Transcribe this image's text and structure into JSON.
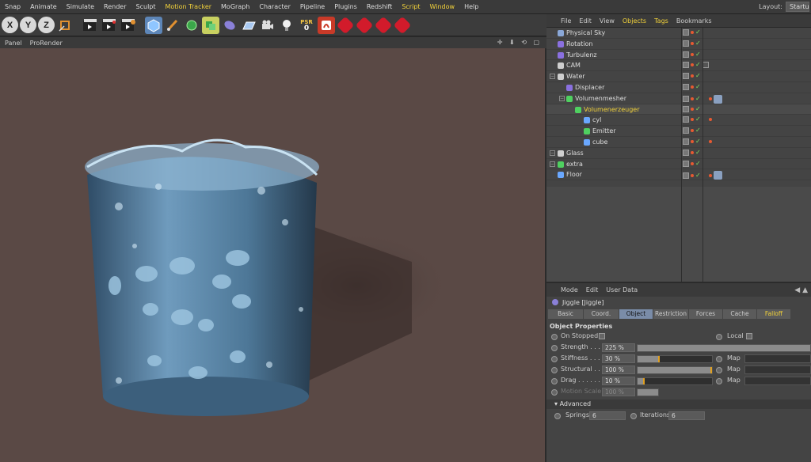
{
  "menubar": {
    "items": [
      "Snap",
      "Animate",
      "Simulate",
      "Render",
      "Sculpt",
      "Motion Tracker",
      "MoGraph",
      "Character",
      "Pipeline",
      "Plugins",
      "Redshift",
      "Script",
      "Window",
      "Help"
    ],
    "layout_label": "Layout:",
    "layout_value": "Startup"
  },
  "toolbar": {
    "axis": [
      "X",
      "Y",
      "Z"
    ],
    "psr_label": "PSR",
    "psr_value": "0"
  },
  "viewport": {
    "menu": [
      "Panel",
      "ProRender"
    ],
    "nav_icons": "✛ ⬇ ⟲ ▢"
  },
  "objects": {
    "menu": [
      "File",
      "Edit",
      "View",
      "Objects",
      "Tags",
      "Bookmarks"
    ],
    "active_menu": "Objects",
    "rows": [
      {
        "name": "Physical Sky",
        "indent": 0,
        "color": "#8aa8d8",
        "tag": "none"
      },
      {
        "name": "Rotation",
        "indent": 0,
        "color": "#8a70e0",
        "tag": "none"
      },
      {
        "name": "Turbulenz",
        "indent": 0,
        "color": "#8a70e0",
        "tag": "none"
      },
      {
        "name": "CAM",
        "indent": 0,
        "color": "#cfcfcf",
        "tag": "cam"
      },
      {
        "name": "Water",
        "indent": 0,
        "color": "#cfcfcf",
        "tag": "none"
      },
      {
        "name": "Displacer",
        "indent": 1,
        "color": "#8a70e0",
        "tag": "none"
      },
      {
        "name": "Volumenmesher",
        "indent": 1,
        "color": "#4fd060",
        "tag": "img"
      },
      {
        "name": "Volumenerzeuger",
        "indent": 2,
        "color": "#4fd060",
        "tag": "none",
        "selected": true
      },
      {
        "name": "cyl",
        "indent": 3,
        "color": "#6aa8ff",
        "tag": "dot"
      },
      {
        "name": "Emitter",
        "indent": 3,
        "color": "#4fd060",
        "tag": "none"
      },
      {
        "name": "cube",
        "indent": 3,
        "color": "#6aa8ff",
        "tag": "dot"
      },
      {
        "name": "Glass",
        "indent": 0,
        "color": "#cfcfcf",
        "tag": "none"
      },
      {
        "name": "extra",
        "indent": 0,
        "color": "#4fd060",
        "tag": "none"
      },
      {
        "name": "Floor",
        "indent": 0,
        "color": "#6aa8ff",
        "tag": "img"
      }
    ]
  },
  "attributes": {
    "menu": [
      "Mode",
      "Edit",
      "User Data"
    ],
    "title": "Jiggle [Jiggle]",
    "tabs": [
      "Basic",
      "Coord.",
      "Object",
      "Restriction",
      "Forces",
      "Cache",
      "Falloff"
    ],
    "active_tab": "Object",
    "section": "Object Properties",
    "on_stopped_label": "On Stopped",
    "local_label": "Local",
    "props": [
      {
        "label": "Strength . . . .",
        "value": "225 %",
        "fill": 1.0,
        "mark": null,
        "map": false,
        "dim": false
      },
      {
        "label": "Stiffness . . . .",
        "value": "30 %",
        "fill": 0.3,
        "mark": 0.3,
        "map": true,
        "dim": false
      },
      {
        "label": "Structural . .",
        "value": "100 %",
        "fill": 1.0,
        "mark": 1.0,
        "map": true,
        "dim": false
      },
      {
        "label": "Drag . . . . . .",
        "value": "10 %",
        "fill": 0.1,
        "mark": 0.1,
        "map": true,
        "dim": false
      },
      {
        "label": "Motion Scale",
        "value": "100 %",
        "fill": 1.0,
        "mark": null,
        "map": false,
        "dim": true
      }
    ],
    "map_label": "Map",
    "advanced_label": "Advanced",
    "springs_label": "Springs",
    "springs_value": "6",
    "iterations_label": "Iterations",
    "iterations_value": "6"
  }
}
